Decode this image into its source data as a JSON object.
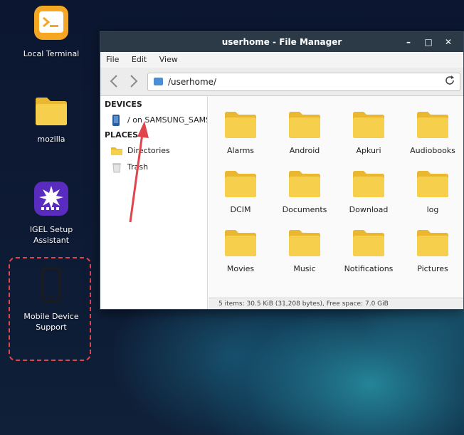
{
  "desktop": {
    "icons": [
      {
        "label": "Local Terminal"
      },
      {
        "label": "mozilla"
      },
      {
        "label": "IGEL Setup Assistant"
      },
      {
        "label": "Mobile Device Support"
      }
    ]
  },
  "window": {
    "title": "userhome - File Manager",
    "controls": {
      "minimize": "–",
      "maximize": "□",
      "close": "✕"
    },
    "menu": [
      "File",
      "Edit",
      "View"
    ],
    "path": "/userhome/",
    "sidebar": {
      "devices_heading": "DEVICES",
      "device_item": "/ on SAMSUNG_SAMSUNG",
      "places_heading": "PLACES",
      "places_items": [
        "Directories",
        "Trash"
      ]
    },
    "folders": [
      "Alarms",
      "Android",
      "Apkuri",
      "Audiobooks",
      "DCIM",
      "Documents",
      "Download",
      "log",
      "Movies",
      "Music",
      "Notifications",
      "Pictures"
    ],
    "status": "5 items: 30.5 KiB (31,208 bytes), Free space: 7.0 GiB"
  },
  "colors": {
    "annotation": "#e0454e",
    "folder": "#f6d04d",
    "titlebar": "#2b3a46"
  }
}
